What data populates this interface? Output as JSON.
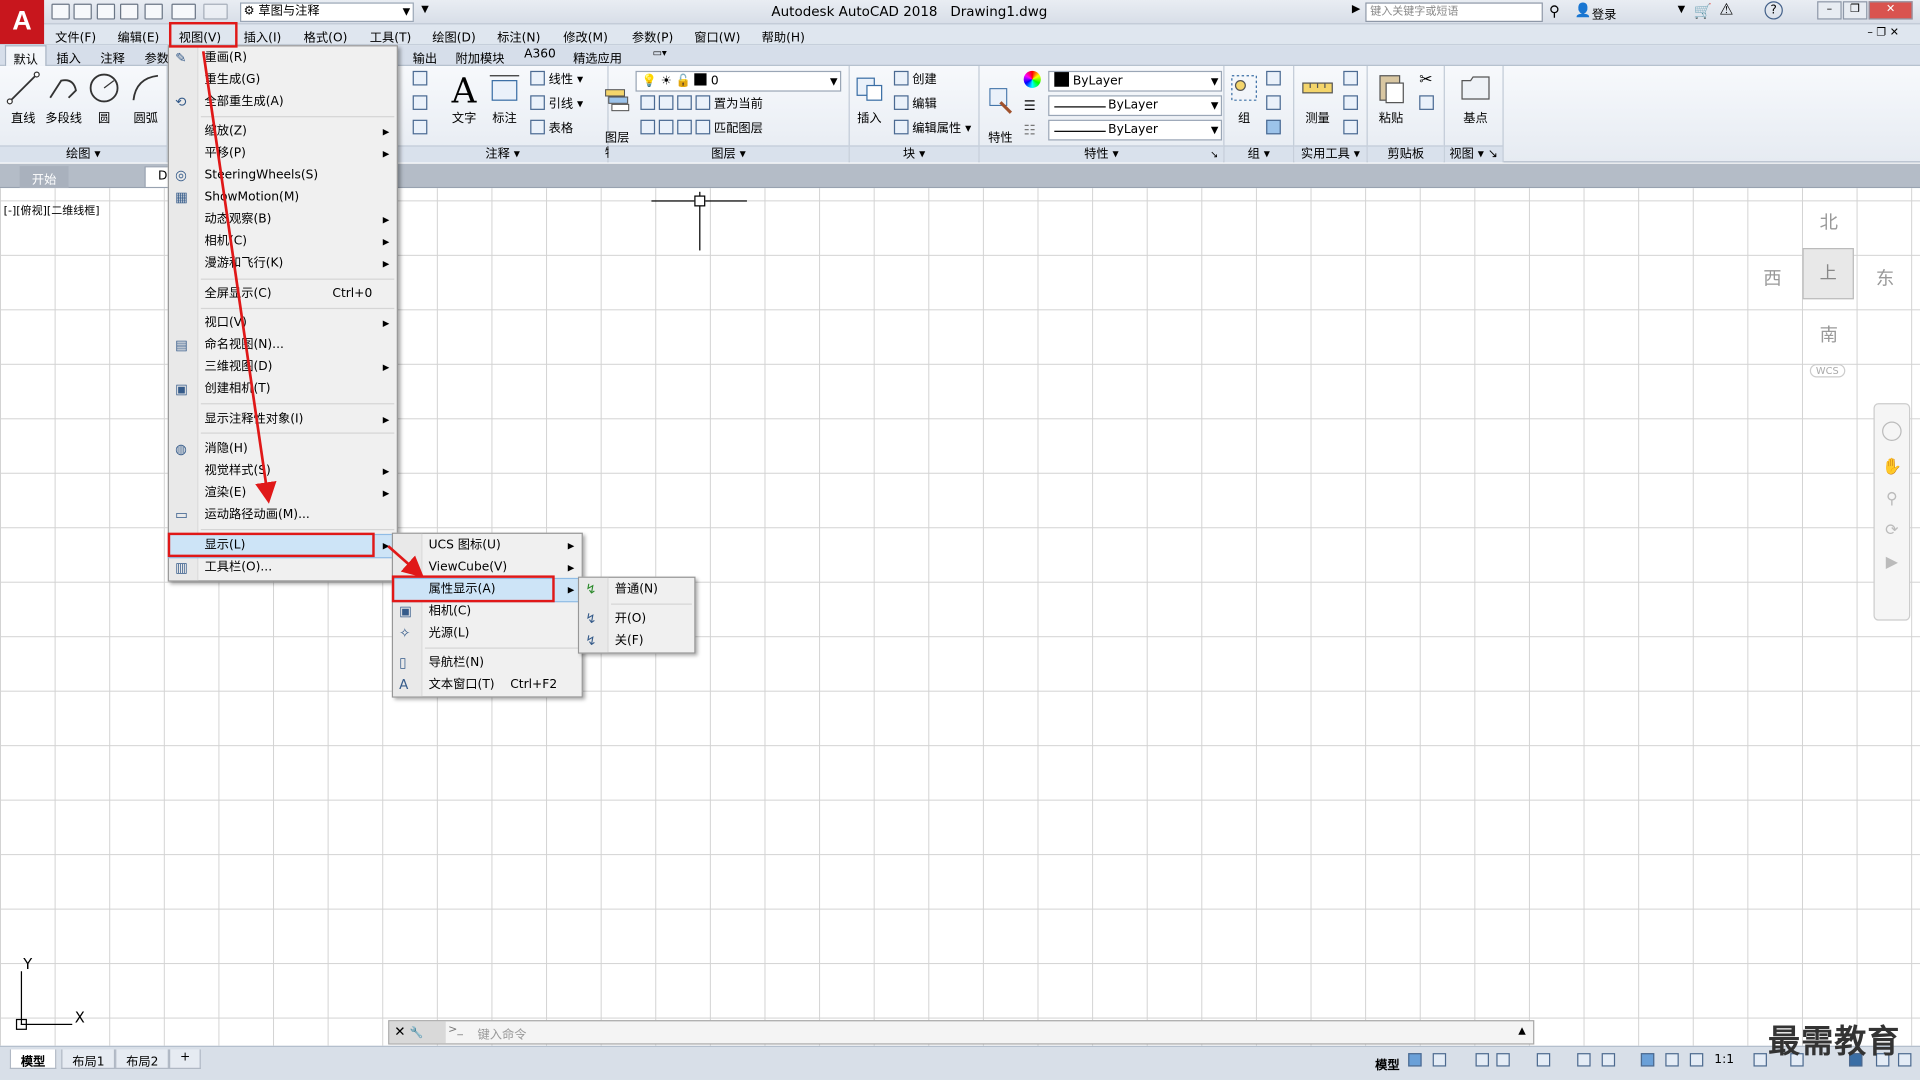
{
  "app": {
    "title": "Autodesk AutoCAD 2018",
    "file": "Drawing1.dwg",
    "logo": "A",
    "workspace": "草图与注释",
    "search_placeholder": "键入关键字或短语",
    "signin": "登录",
    "help": "?"
  },
  "menubar": [
    "文件(F)",
    "编辑(E)",
    "视图(V)",
    "插入(I)",
    "格式(O)",
    "工具(T)",
    "绘图(D)",
    "标注(N)",
    "修改(M)",
    "参数(P)",
    "窗口(W)",
    "帮助(H)"
  ],
  "ribbon_tabs": [
    "默认",
    "插入",
    "注释",
    "参数",
    "输出",
    "附加模块",
    "A360",
    "精选应用"
  ],
  "ribbon": {
    "draw": {
      "title": "绘图",
      "line": "直线",
      "polyline": "多段线",
      "circle": "圆",
      "arc": "圆弧"
    },
    "annotation": {
      "title": "注释",
      "text": "文字",
      "dimension": "标注",
      "linear": "线性",
      "leader": "引线",
      "table": "表格",
      "text_icon": "A"
    },
    "layers": {
      "title": "图层",
      "properties": "图层\n特性",
      "current_layer": "0",
      "make_current": "置为当前",
      "match_layer": "匹配图层"
    },
    "block": {
      "title": "块",
      "insert": "插入",
      "create": "创建",
      "edit": "编辑",
      "edit_attr": "编辑属性"
    },
    "properties": {
      "title": "特性",
      "match": "特性\n匹配",
      "color": "ByLayer",
      "linetype": "ByLayer",
      "lineweight": "ByLayer"
    },
    "groups": {
      "title": "组",
      "group": "组"
    },
    "utilities": {
      "title": "实用工具",
      "measure": "测量"
    },
    "clipboard": {
      "title": "剪贴板",
      "paste": "粘贴"
    },
    "view": {
      "title": "视图",
      "base": "基点"
    }
  },
  "file_tabs": [
    "开始",
    "Dr"
  ],
  "viewport_label": "[-][俯视][二维线框]",
  "viewcube": {
    "north": "北",
    "south": "南",
    "east": "东",
    "west": "西",
    "face": "上",
    "wcs": "WCS"
  },
  "ucs": {
    "x": "X",
    "y": "Y"
  },
  "command": {
    "placeholder": "键入命令",
    "close": "✕",
    "wrench": "🔧",
    "prompt_icon": ">_"
  },
  "layout_tabs": [
    "模型",
    "布局1",
    "布局2",
    "+"
  ],
  "status": {
    "model": "模型",
    "scale": "1:1"
  },
  "watermark": "最需教育",
  "view_menu": [
    {
      "label": "重画(R)",
      "icon": "pencil-icon"
    },
    {
      "label": "重生成(G)"
    },
    {
      "label": "全部重生成(A)",
      "icon": "regen-all-icon"
    },
    {
      "label": "缩放(Z)",
      "sub": true
    },
    {
      "label": "平移(P)",
      "sub": true
    },
    {
      "label": "SteeringWheels(S)",
      "icon": "steering-wheel-icon"
    },
    {
      "label": "ShowMotion(M)",
      "icon": "showmotion-icon"
    },
    {
      "label": "动态观察(B)",
      "sub": true
    },
    {
      "label": "相机(C)",
      "sub": true
    },
    {
      "label": "漫游和飞行(K)",
      "sub": true
    },
    {
      "label": "全屏显示(C)",
      "shortcut": "Ctrl+0"
    },
    {
      "label": "视口(V)",
      "sub": true
    },
    {
      "label": "命名视图(N)...",
      "icon": "named-view-icon"
    },
    {
      "label": "三维视图(D)",
      "sub": true
    },
    {
      "label": "创建相机(T)",
      "icon": "create-camera-icon"
    },
    {
      "label": "显示注释性对象(I)",
      "sub": true
    },
    {
      "label": "消隐(H)",
      "icon": "hide-icon"
    },
    {
      "label": "视觉样式(S)",
      "sub": true
    },
    {
      "label": "渲染(E)",
      "sub": true
    },
    {
      "label": "运动路径动画(M)...",
      "icon": "motion-path-icon"
    },
    {
      "label": "显示(L)",
      "sub": true
    },
    {
      "label": "工具栏(O)...",
      "icon": "toolbar-icon"
    }
  ],
  "display_menu": [
    {
      "label": "UCS 图标(U)",
      "sub": true
    },
    {
      "label": "ViewCube(V)",
      "sub": true
    },
    {
      "label": "属性显示(A)",
      "sub": true
    },
    {
      "label": "相机(C)",
      "icon": "camera-icon"
    },
    {
      "label": "光源(L)",
      "icon": "light-icon"
    },
    {
      "label": "导航栏(N)",
      "icon": "navbar-icon"
    },
    {
      "label": "文本窗口(T)",
      "shortcut": "Ctrl+F2",
      "icon": "text-window-icon"
    }
  ],
  "attr_menu": [
    {
      "label": "普通(N)"
    },
    {
      "label": "开(O)"
    },
    {
      "label": "关(F)"
    }
  ],
  "colors": {
    "accent_red": "#e01818",
    "menu_highlight": "#cde4f7",
    "logo_red": "#c8161d"
  }
}
